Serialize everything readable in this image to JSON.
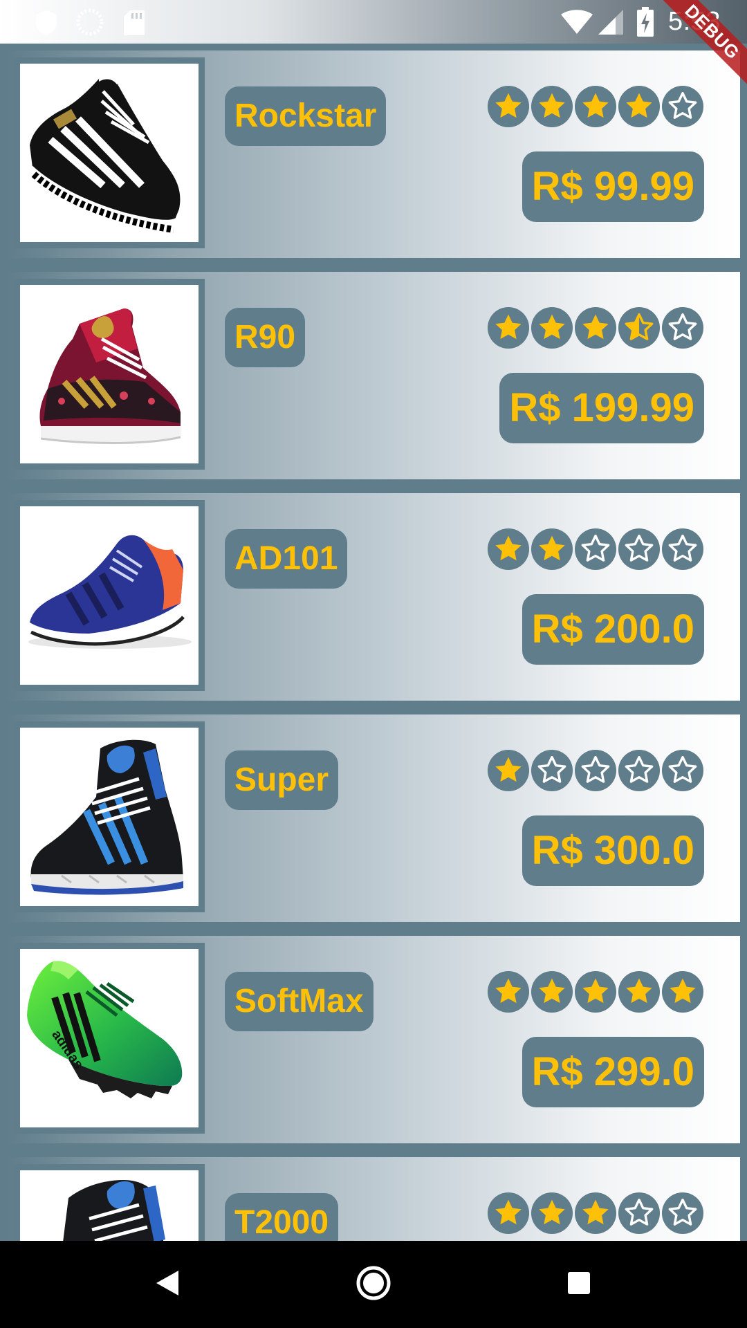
{
  "status_bar": {
    "time": "5:53",
    "left_icons": [
      "shield-icon",
      "sync-icon",
      "sd-card-icon"
    ],
    "right_icons": [
      "wifi-icon",
      "signal-icon",
      "battery-charging-icon"
    ]
  },
  "debug_banner": "DEBUG",
  "colors": {
    "card_accent": "#607d8b",
    "label_text": "#ffc107",
    "star_fill": "#ffc107",
    "star_empty": "#ffffff"
  },
  "products": [
    {
      "name": "Rockstar",
      "price": "R$ 99.99",
      "rating": 4,
      "image": "black-white-sneaker-image"
    },
    {
      "name": "R90",
      "price": "R$ 199.99",
      "rating": 3.5,
      "image": "floral-high-top-sneaker-image"
    },
    {
      "name": "AD101",
      "price": "R$ 200.0",
      "rating": 2,
      "image": "blue-running-shoe-image"
    },
    {
      "name": "Super",
      "price": "R$ 300.0",
      "rating": 1,
      "image": "black-blue-high-top-image"
    },
    {
      "name": "SoftMax",
      "price": "R$ 299.0",
      "rating": 5,
      "image": "green-football-boot-image"
    },
    {
      "name": "T2000",
      "price": "",
      "rating": 3,
      "image": "black-blue-high-top-image"
    }
  ],
  "nav_bar": {
    "buttons": [
      "back-icon",
      "home-icon",
      "recents-icon"
    ]
  }
}
